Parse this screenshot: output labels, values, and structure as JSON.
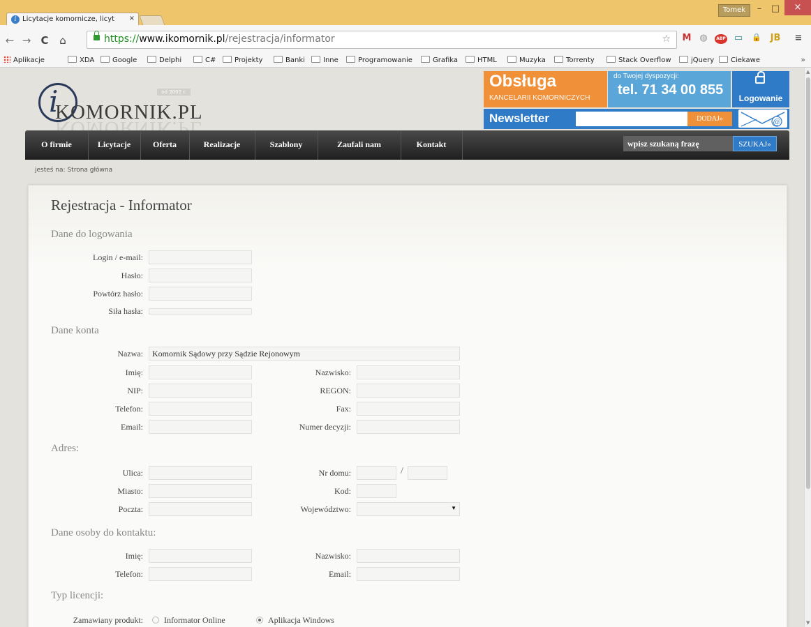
{
  "browser": {
    "tab_title": "Licytacje komornicze, licyt",
    "tab_close": "×",
    "user_name": "Tomek",
    "window_buttons": {
      "minimize": "–",
      "maximize": "□",
      "close": "×"
    },
    "nav": {
      "back": "←",
      "forward": "→",
      "reload": "C",
      "home": "⌂"
    },
    "url_scheme": "https://",
    "url_host": "www.ikomornik.pl",
    "url_path": "/rejestracja/informator",
    "star": "☆",
    "extensions": [
      "M",
      "◍",
      "ABP",
      "▭",
      "🔒",
      "JB",
      "≡"
    ],
    "bookmarks": [
      "Aplikacje",
      "XDA",
      "Google",
      "Delphi",
      "C#",
      "Projekty",
      "Banki",
      "Inne",
      "Programowanie",
      "Grafika",
      "HTML",
      "Muzyka",
      "Torrenty",
      "Stack Overflow",
      "jQuery",
      "Ciekawe"
    ],
    "bookmarks_more": "»"
  },
  "header": {
    "logo_letter": "i",
    "logo_text": "KOMORNIK.PL",
    "logo_since": "od 2002 r.",
    "obsluga_title": "Obsługa",
    "obsluga_sub": "KANCELARII KOMORNICZYCH",
    "disp_label": "do Twojej dyspozycji:",
    "phone": "tel. 71 34 00 855",
    "login": "Logowanie",
    "newsletter_label": "Newsletter",
    "newsletter_button": "DODAJ»",
    "newsletter_icon_text": "@"
  },
  "menu": {
    "items": [
      "O firmie",
      "Licytacje",
      "Oferta",
      "Realizacje",
      "Szablony",
      "Zaufali nam",
      "Kontakt"
    ],
    "search_placeholder": "wpisz szukaną frazę",
    "search_button": "SZUKAJ»"
  },
  "breadcrumb": "jesteś na: Strona główna",
  "form": {
    "title": "Rejestracja - Informator",
    "sections": {
      "login": "Dane do logowania",
      "account": "Dane konta",
      "address": "Adres:",
      "contact": "Dane osoby do kontaktu:",
      "license": "Typ licencji:"
    },
    "labels": {
      "login": "Login / e-mail:",
      "password": "Hasło:",
      "password_repeat": "Powtórz hasło:",
      "strength": "Siła hasła:",
      "name": "Nazwa:",
      "first_name": "Imię:",
      "last_name": "Nazwisko:",
      "nip": "NIP:",
      "regon": "REGON:",
      "phone": "Telefon:",
      "fax": "Fax:",
      "email": "Email:",
      "decision": "Numer decyzji:",
      "street": "Ulica:",
      "house": "Nr domu:",
      "city": "Miasto:",
      "zip": "Kod:",
      "post": "Poczta:",
      "voivodeship": "Województwo:",
      "c_first_name": "Imię:",
      "c_last_name": "Nazwisko:",
      "c_phone": "Telefon:",
      "c_email": "Email:",
      "product": "Zamawiany produkt:"
    },
    "values": {
      "name": "Komornik Sądowy przy Sądzie Rejonowym",
      "voivodeship_arrow": "▼"
    },
    "house_separator": "/",
    "product_options": [
      {
        "label": "Informator Online",
        "selected": false
      },
      {
        "label": "Aplikacja Windows",
        "selected": true
      }
    ]
  }
}
